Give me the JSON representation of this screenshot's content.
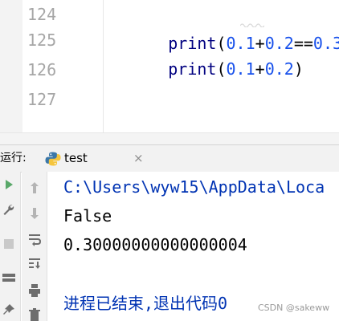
{
  "editor": {
    "lines": [
      {
        "number": "124",
        "tokens": {
          "fn": "print",
          "open": "(",
          "a": "0.1",
          "plus": "+",
          "b": "0.2",
          "eq": "==",
          "c": "0.3",
          "close": ")"
        }
      },
      {
        "number": "125",
        "tokens": {
          "fn": "print",
          "open": "(",
          "a": "0.1",
          "plus": "+",
          "b": "0.2",
          "close": ")"
        }
      },
      {
        "number": "126"
      },
      {
        "number": "127"
      }
    ]
  },
  "run": {
    "title": "运行:",
    "tab_label": "test",
    "tab_close": "×",
    "python_icon": "python-icon"
  },
  "toolbar": {
    "left": [
      "run-icon",
      "wrench-icon",
      "stop-icon",
      "layout-icon",
      "pin-icon"
    ],
    "right": [
      "up-arrow-icon",
      "down-arrow-icon",
      "soft-wrap-icon",
      "scroll-to-end-icon",
      "print-icon",
      "delete-icon"
    ]
  },
  "console": {
    "path": "C:\\Users\\wyw15\\AppData\\Loca",
    "false_output": "False",
    "float_output": "0.30000000000000004",
    "exit_message": "进程已结束,退出代码0"
  },
  "watermark": "CSDN @sakeww",
  "colors": {
    "keyword": "#000080",
    "number": "#1750eb",
    "console_path": "#0033b3",
    "run_green": "#59a869"
  }
}
